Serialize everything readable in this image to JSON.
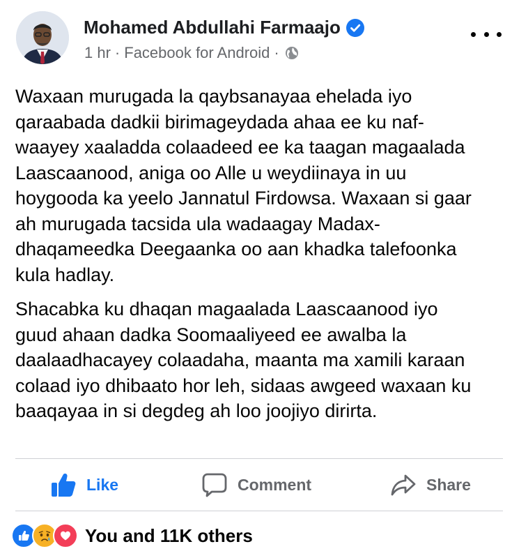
{
  "post": {
    "author": "Mohamed Abdullahi Farmaajo",
    "time": "1 hr",
    "separator": "·",
    "source": "Facebook for Android",
    "paragraphs": [
      "Waxaan murugada la qaybsanayaa ehelada iyo\nqaraabada dadkii birimageydada ahaa ee ku naf-\nwaayey xaaladda colaadeed ee ka taagan magaalada\nLaascaanood, aniga oo Alle u weydiinaya in uu\nhoygooda ka yeelo Jannatul Firdowsa. Waxaan si gaar\nah murugada tacsida ula wadaagay Madax-\ndhaqameedka Deegaanka oo aan khadka talefoonka\nkula hadlay.",
      "Shacabka ku dhaqan magaalada Laascaanood iyo\nguud ahaan dadka Soomaaliyeed ee awalba la\ndaalaadhacayey colaadaha, maanta ma xamili karaan\ncolaad iyo dhibaato hor leh, sidaas awgeed waxaan ku\nbaaqayaa in si degdeg ah loo joojiyo dirirta."
    ]
  },
  "actions": {
    "like": "Like",
    "comment": "Comment",
    "share": "Share"
  },
  "reactions": {
    "icons": [
      "like-reaction-icon",
      "sad-reaction-icon",
      "love-reaction-icon"
    ],
    "summary": "You and 11K others"
  },
  "colors": {
    "accent": "#1877f2",
    "text": "#050505",
    "muted": "#65676b",
    "love": "#f33e58",
    "sad": "#f7b125"
  }
}
